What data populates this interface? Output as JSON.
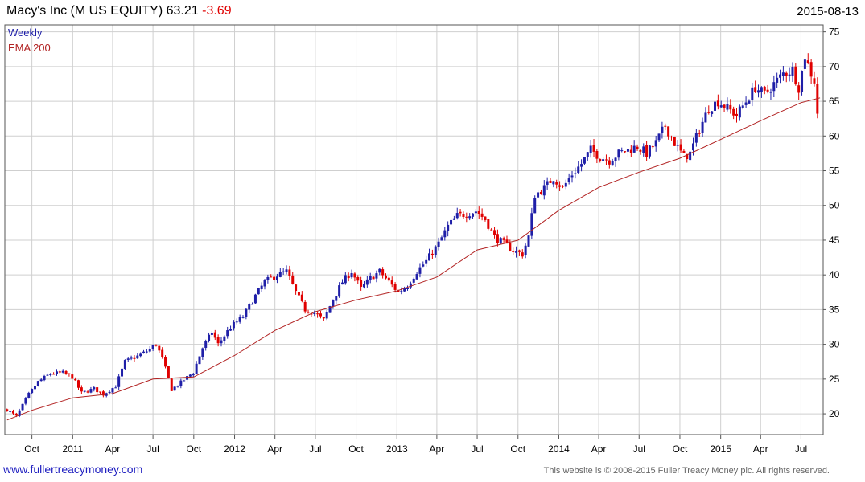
{
  "header": {
    "title": "Macy's Inc (M US EQUITY) 63.21",
    "change": "-3.69",
    "date": "2015-08-13"
  },
  "footer": {
    "link": "www.fullertreacymoney.com",
    "copyright": "This website is © 2008-2015 Fuller Treacy Money plc. All rights reserved."
  },
  "chart_data": {
    "type": "candlestick",
    "legend": [
      {
        "name": "Weekly",
        "color": "#1f1fa8"
      },
      {
        "name": "EMA 200",
        "color": "#b22222"
      }
    ],
    "legend_position": "top-left",
    "up_color": "#1f1fa8",
    "down_color": "#e00000",
    "ylim": [
      17,
      76
    ],
    "yticks": [
      20,
      25,
      30,
      35,
      40,
      45,
      50,
      55,
      60,
      65,
      70,
      75
    ],
    "y_axis_side": "right",
    "grid": true,
    "xlim": [
      "2010-08-01",
      "2015-08-20"
    ],
    "xticks": [
      {
        "date": "2010-10-01",
        "label": "Oct"
      },
      {
        "date": "2011-01-01",
        "label": "2011"
      },
      {
        "date": "2011-04-01",
        "label": "Apr"
      },
      {
        "date": "2011-07-01",
        "label": "Jul"
      },
      {
        "date": "2011-10-01",
        "label": "Oct"
      },
      {
        "date": "2012-01-01",
        "label": "2012"
      },
      {
        "date": "2012-04-01",
        "label": "Apr"
      },
      {
        "date": "2012-07-01",
        "label": "Jul"
      },
      {
        "date": "2012-10-01",
        "label": "Oct"
      },
      {
        "date": "2013-01-01",
        "label": "2013"
      },
      {
        "date": "2013-04-01",
        "label": "Apr"
      },
      {
        "date": "2013-07-01",
        "label": "Jul"
      },
      {
        "date": "2013-10-01",
        "label": "Oct"
      },
      {
        "date": "2014-01-01",
        "label": "2014"
      },
      {
        "date": "2014-04-01",
        "label": "Apr"
      },
      {
        "date": "2014-07-01",
        "label": "Jul"
      },
      {
        "date": "2014-10-01",
        "label": "Oct"
      },
      {
        "date": "2015-01-01",
        "label": "2015"
      },
      {
        "date": "2015-04-01",
        "label": "Apr"
      },
      {
        "date": "2015-07-01",
        "label": "Jul"
      }
    ],
    "price_path": [
      [
        "2010-08-06",
        20.6
      ],
      [
        "2010-08-27",
        19.6
      ],
      [
        "2010-09-24",
        22.8
      ],
      [
        "2010-10-15",
        24.6
      ],
      [
        "2010-11-12",
        25.8
      ],
      [
        "2010-12-10",
        25.9
      ],
      [
        "2010-12-31",
        25.3
      ],
      [
        "2011-01-21",
        23.0
      ],
      [
        "2011-02-18",
        23.6
      ],
      [
        "2011-03-11",
        22.8
      ],
      [
        "2011-04-08",
        24.0
      ],
      [
        "2011-04-29",
        27.5
      ],
      [
        "2011-05-27",
        28.3
      ],
      [
        "2011-06-17",
        29.0
      ],
      [
        "2011-07-08",
        30.0
      ],
      [
        "2011-07-22",
        28.0
      ],
      [
        "2011-08-12",
        23.5
      ],
      [
        "2011-09-02",
        24.5
      ],
      [
        "2011-09-30",
        26.0
      ],
      [
        "2011-10-21",
        29.5
      ],
      [
        "2011-11-11",
        31.8
      ],
      [
        "2011-11-25",
        30.0
      ],
      [
        "2011-12-23",
        32.5
      ],
      [
        "2012-01-20",
        34.0
      ],
      [
        "2012-02-17",
        37.0
      ],
      [
        "2012-03-09",
        39.0
      ],
      [
        "2012-04-06",
        40.0
      ],
      [
        "2012-04-27",
        40.5
      ],
      [
        "2012-05-18",
        37.5
      ],
      [
        "2012-06-08",
        35.0
      ],
      [
        "2012-06-29",
        34.5
      ],
      [
        "2012-07-20",
        33.5
      ],
      [
        "2012-08-10",
        36.5
      ],
      [
        "2012-08-31",
        39.0
      ],
      [
        "2012-09-21",
        40.5
      ],
      [
        "2012-10-12",
        38.0
      ],
      [
        "2012-11-02",
        39.5
      ],
      [
        "2012-11-23",
        40.5
      ],
      [
        "2012-12-14",
        39.0
      ],
      [
        "2013-01-04",
        37.5
      ],
      [
        "2013-01-25",
        38.5
      ],
      [
        "2013-02-15",
        40.5
      ],
      [
        "2013-03-08",
        42.0
      ],
      [
        "2013-04-05",
        44.5
      ],
      [
        "2013-04-26",
        47.0
      ],
      [
        "2013-05-17",
        48.5
      ],
      [
        "2013-06-07",
        48.8
      ],
      [
        "2013-06-28",
        49.2
      ],
      [
        "2013-07-19",
        48.0
      ],
      [
        "2013-08-09",
        45.5
      ],
      [
        "2013-08-30",
        44.5
      ],
      [
        "2013-09-20",
        43.5
      ],
      [
        "2013-10-11",
        43.0
      ],
      [
        "2013-10-25",
        45.5
      ],
      [
        "2013-11-08",
        51.5
      ],
      [
        "2013-11-29",
        52.5
      ],
      [
        "2013-12-20",
        54.0
      ],
      [
        "2014-01-10",
        52.5
      ],
      [
        "2014-01-31",
        54.5
      ],
      [
        "2014-02-21",
        56.0
      ],
      [
        "2014-03-14",
        58.0
      ],
      [
        "2014-04-04",
        57.0
      ],
      [
        "2014-04-25",
        56.5
      ],
      [
        "2014-05-16",
        57.5
      ],
      [
        "2014-06-06",
        58.0
      ],
      [
        "2014-06-27",
        58.5
      ],
      [
        "2014-07-18",
        57.5
      ],
      [
        "2014-08-08",
        59.0
      ],
      [
        "2014-08-29",
        61.5
      ],
      [
        "2014-09-19",
        59.0
      ],
      [
        "2014-10-10",
        57.0
      ],
      [
        "2014-10-24",
        57.5
      ],
      [
        "2014-11-14",
        61.0
      ],
      [
        "2014-12-05",
        64.0
      ],
      [
        "2014-12-26",
        65.0
      ],
      [
        "2015-01-16",
        64.0
      ],
      [
        "2015-02-06",
        63.0
      ],
      [
        "2015-02-27",
        65.0
      ],
      [
        "2015-03-20",
        67.0
      ],
      [
        "2015-04-10",
        66.0
      ],
      [
        "2015-05-01",
        67.5
      ],
      [
        "2015-05-22",
        69.0
      ],
      [
        "2015-06-12",
        69.5
      ],
      [
        "2015-06-26",
        67.0
      ],
      [
        "2015-07-10",
        71.5
      ],
      [
        "2015-07-24",
        69.0
      ],
      [
        "2015-08-07",
        66.9
      ],
      [
        "2015-08-13",
        63.21
      ]
    ],
    "ema200_path": [
      [
        "2010-08-06",
        19.1
      ],
      [
        "2010-10-01",
        20.5
      ],
      [
        "2011-01-01",
        22.3
      ],
      [
        "2011-04-01",
        22.9
      ],
      [
        "2011-07-01",
        25.0
      ],
      [
        "2011-10-01",
        25.3
      ],
      [
        "2012-01-01",
        28.4
      ],
      [
        "2012-04-01",
        32.0
      ],
      [
        "2012-07-01",
        34.7
      ],
      [
        "2012-10-01",
        36.4
      ],
      [
        "2013-01-01",
        37.7
      ],
      [
        "2013-04-01",
        39.7
      ],
      [
        "2013-07-01",
        43.6
      ],
      [
        "2013-10-01",
        45.0
      ],
      [
        "2014-01-01",
        49.3
      ],
      [
        "2014-04-01",
        52.6
      ],
      [
        "2014-07-01",
        54.8
      ],
      [
        "2014-10-01",
        56.8
      ],
      [
        "2015-01-01",
        59.5
      ],
      [
        "2015-04-01",
        62.2
      ],
      [
        "2015-07-01",
        64.8
      ],
      [
        "2015-08-13",
        65.5
      ]
    ]
  }
}
